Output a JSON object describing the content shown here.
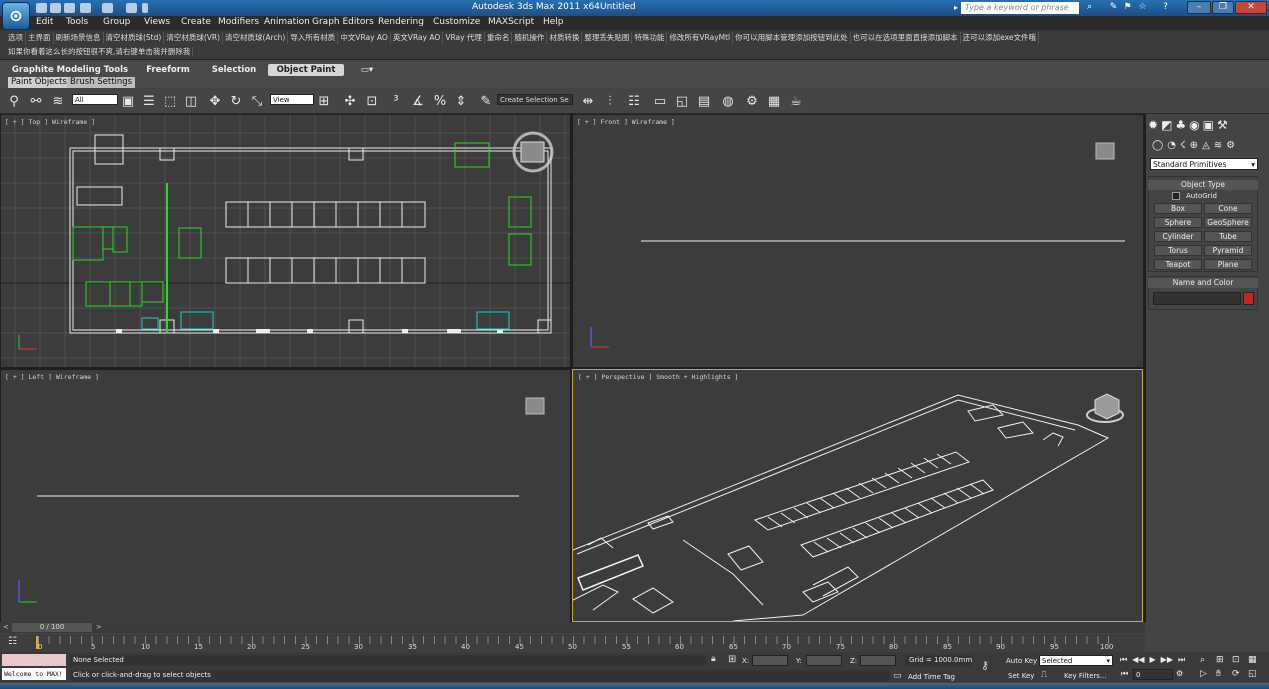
{
  "titlebar": {
    "app_title": "Autodesk 3ds Max  2011 x64",
    "file_title": "Untitled",
    "search_placeholder": "Type a keyword or phrase",
    "app_icon": "3ds-max-logo-icon"
  },
  "menu": [
    "Edit",
    "Tools",
    "Group",
    "Views",
    "Create",
    "Modifiers",
    "Animation",
    "Graph Editors",
    "Rendering",
    "Customize",
    "MAXScript",
    "Help"
  ],
  "custom_toolbar": {
    "row1": [
      "选项",
      "主界面",
      "刷新场景信息",
      "清空材质球(Std)",
      "清空材质球(VR)",
      "清空材质球(Arch)",
      "导入所有材质",
      "中文VRay AO",
      "英文VRay AO",
      "VRay 代理",
      "重命名",
      "随机操作",
      "材质转换",
      "整理丢失贴图",
      "特殊功能",
      "修改所有VRayMtl",
      "你可以用脚本管理添加按钮到此处",
      "也可以在选项里面直接添加脚本",
      "还可以添加exe文件哦"
    ],
    "row2": [
      "如果你看着这么长的按钮很不爽,请右键单击我并删除我"
    ]
  },
  "ribbon": {
    "tabs": [
      "Graphite Modeling Tools",
      "Freeform",
      "Selection",
      "Object Paint"
    ],
    "active_tab": "Object Paint",
    "subtabs": [
      "Paint Objects",
      "Brush Settings"
    ]
  },
  "main_toolbar": {
    "filter_value": "All",
    "refcoord_value": "View",
    "named_sel_placeholder": "Create Selection Se"
  },
  "viewports": {
    "top": "[ + ] Top ] Wireframe ]",
    "front": "[ + ] Front ] Wireframe ]",
    "left": "[ + ] Left ] Wireframe ]",
    "perspective": "[ + ] Perspective ] Smooth + Highlights ]"
  },
  "command_panel": {
    "category": "Standard Primitives",
    "object_type_title": "Object Type",
    "autogrid": "AutoGrid",
    "buttons": [
      "Box",
      "Cone",
      "Sphere",
      "GeoSphere",
      "Cylinder",
      "Tube",
      "Torus",
      "Pyramid",
      "Teapot",
      "Plane"
    ],
    "name_color_title": "Name and Color",
    "object_color": "#c0282a"
  },
  "timeline": {
    "frame_counter": "0 / 100",
    "ticks": [
      "0",
      "5",
      "10",
      "15",
      "20",
      "25",
      "30",
      "35",
      "40",
      "45",
      "50",
      "55",
      "60",
      "65",
      "70",
      "75",
      "80",
      "85",
      "90",
      "95",
      "100"
    ]
  },
  "status": {
    "maxscript_listener": "Welcome to MAX!",
    "selection_status": "None Selected",
    "prompt": "Click or click-and-drag to select objects",
    "x_label": "X:",
    "y_label": "Y:",
    "z_label": "Z:",
    "grid": "Grid = 1000.0mm",
    "add_time_tag": "Add Time Tag",
    "auto_key": "Auto Key",
    "set_key": "Set Key",
    "key_mode_value": "Selected",
    "key_filters": "Key Filters...",
    "frame_value": "0"
  },
  "colors": {
    "accent_title": "#2a6fb0",
    "selection_green": "#22dd22",
    "selection_cyan": "#22cccc",
    "active_viewport_border": "#c8a840"
  }
}
